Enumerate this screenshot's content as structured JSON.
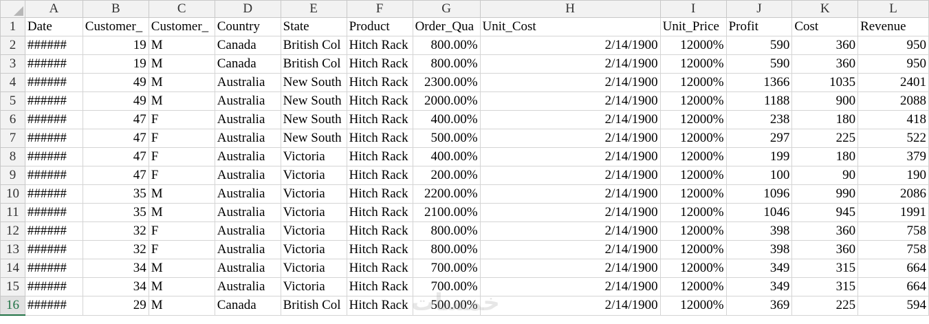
{
  "columns": [
    "A",
    "B",
    "C",
    "D",
    "E",
    "F",
    "G",
    "H",
    "I",
    "J",
    "K",
    "L"
  ],
  "headers": [
    "Date",
    "Customer_",
    "Customer_",
    "Country",
    "State",
    "Product",
    "Order_Qua",
    "Unit_Cost",
    "Unit_Price",
    "Profit",
    "Cost",
    "Revenue"
  ],
  "rows": [
    {
      "n": "2",
      "date": "######",
      "age": "19",
      "gender": "M",
      "country": "Canada",
      "state": "British Col",
      "product": "Hitch Rack",
      "qty": "800.00%",
      "unit_cost": "2/14/1900",
      "unit_price": "12000%",
      "profit": "590",
      "cost": "360",
      "revenue": "950"
    },
    {
      "n": "3",
      "date": "######",
      "age": "19",
      "gender": "M",
      "country": "Canada",
      "state": "British Col",
      "product": "Hitch Rack",
      "qty": "800.00%",
      "unit_cost": "2/14/1900",
      "unit_price": "12000%",
      "profit": "590",
      "cost": "360",
      "revenue": "950"
    },
    {
      "n": "4",
      "date": "######",
      "age": "49",
      "gender": "M",
      "country": "Australia",
      "state": "New South",
      "product": "Hitch Rack",
      "qty": "2300.00%",
      "unit_cost": "2/14/1900",
      "unit_price": "12000%",
      "profit": "1366",
      "cost": "1035",
      "revenue": "2401"
    },
    {
      "n": "5",
      "date": "######",
      "age": "49",
      "gender": "M",
      "country": "Australia",
      "state": "New South",
      "product": "Hitch Rack",
      "qty": "2000.00%",
      "unit_cost": "2/14/1900",
      "unit_price": "12000%",
      "profit": "1188",
      "cost": "900",
      "revenue": "2088"
    },
    {
      "n": "6",
      "date": "######",
      "age": "47",
      "gender": "F",
      "country": "Australia",
      "state": "New South",
      "product": "Hitch Rack",
      "qty": "400.00%",
      "unit_cost": "2/14/1900",
      "unit_price": "12000%",
      "profit": "238",
      "cost": "180",
      "revenue": "418"
    },
    {
      "n": "7",
      "date": "######",
      "age": "47",
      "gender": "F",
      "country": "Australia",
      "state": "New South",
      "product": "Hitch Rack",
      "qty": "500.00%",
      "unit_cost": "2/14/1900",
      "unit_price": "12000%",
      "profit": "297",
      "cost": "225",
      "revenue": "522"
    },
    {
      "n": "8",
      "date": "######",
      "age": "47",
      "gender": "F",
      "country": "Australia",
      "state": "Victoria",
      "product": "Hitch Rack",
      "qty": "400.00%",
      "unit_cost": "2/14/1900",
      "unit_price": "12000%",
      "profit": "199",
      "cost": "180",
      "revenue": "379"
    },
    {
      "n": "9",
      "date": "######",
      "age": "47",
      "gender": "F",
      "country": "Australia",
      "state": "Victoria",
      "product": "Hitch Rack",
      "qty": "200.00%",
      "unit_cost": "2/14/1900",
      "unit_price": "12000%",
      "profit": "100",
      "cost": "90",
      "revenue": "190"
    },
    {
      "n": "10",
      "date": "######",
      "age": "35",
      "gender": "M",
      "country": "Australia",
      "state": "Victoria",
      "product": "Hitch Rack",
      "qty": "2200.00%",
      "unit_cost": "2/14/1900",
      "unit_price": "12000%",
      "profit": "1096",
      "cost": "990",
      "revenue": "2086"
    },
    {
      "n": "11",
      "date": "######",
      "age": "35",
      "gender": "M",
      "country": "Australia",
      "state": "Victoria",
      "product": "Hitch Rack",
      "qty": "2100.00%",
      "unit_cost": "2/14/1900",
      "unit_price": "12000%",
      "profit": "1046",
      "cost": "945",
      "revenue": "1991"
    },
    {
      "n": "12",
      "date": "######",
      "age": "32",
      "gender": "F",
      "country": "Australia",
      "state": "Victoria",
      "product": "Hitch Rack",
      "qty": "800.00%",
      "unit_cost": "2/14/1900",
      "unit_price": "12000%",
      "profit": "398",
      "cost": "360",
      "revenue": "758"
    },
    {
      "n": "13",
      "date": "######",
      "age": "32",
      "gender": "F",
      "country": "Australia",
      "state": "Victoria",
      "product": "Hitch Rack",
      "qty": "800.00%",
      "unit_cost": "2/14/1900",
      "unit_price": "12000%",
      "profit": "398",
      "cost": "360",
      "revenue": "758"
    },
    {
      "n": "14",
      "date": "######",
      "age": "34",
      "gender": "M",
      "country": "Australia",
      "state": "Victoria",
      "product": "Hitch Rack",
      "qty": "700.00%",
      "unit_cost": "2/14/1900",
      "unit_price": "12000%",
      "profit": "349",
      "cost": "315",
      "revenue": "664"
    },
    {
      "n": "15",
      "date": "######",
      "age": "34",
      "gender": "M",
      "country": "Australia",
      "state": "Victoria",
      "product": "Hitch Rack",
      "qty": "700.00%",
      "unit_cost": "2/14/1900",
      "unit_price": "12000%",
      "profit": "349",
      "cost": "315",
      "revenue": "664"
    },
    {
      "n": "16",
      "date": "######",
      "age": "29",
      "gender": "M",
      "country": "Canada",
      "state": "British Col",
      "product": "Hitch Rack",
      "qty": "500.00%",
      "unit_cost": "2/14/1900",
      "unit_price": "12000%",
      "profit": "369",
      "cost": "225",
      "revenue": "594"
    }
  ],
  "header_row_number": "1",
  "selected_row": "16",
  "watermark": "خمسات"
}
